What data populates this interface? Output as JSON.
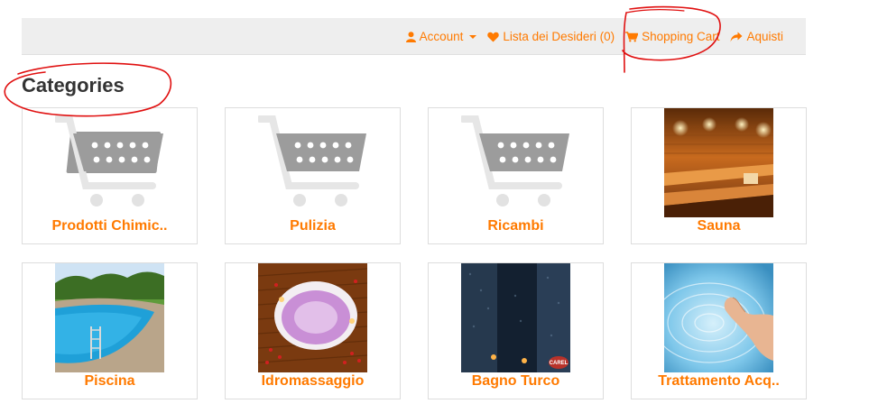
{
  "topnav": {
    "account_label": "Account",
    "wishlist_label": "Lista dei Desideri (0)",
    "cart_label": "Shopping Cart",
    "checkout_label": "Aquisti"
  },
  "page": {
    "title": "Categories"
  },
  "categories": [
    {
      "name": "Prodotti Chimic..",
      "image": "shopping-cart-placeholder"
    },
    {
      "name": "Pulizia",
      "image": "shopping-cart-placeholder"
    },
    {
      "name": "Ricambi",
      "image": "shopping-cart-placeholder"
    },
    {
      "name": "Sauna",
      "image": "sauna-photo"
    },
    {
      "name": "Piscina",
      "image": "pool-photo"
    },
    {
      "name": "Idromassaggio",
      "image": "hot-tub-photo"
    },
    {
      "name": "Bagno Turco",
      "image": "steam-bath-photo"
    },
    {
      "name": "Trattamento Acq..",
      "image": "water-hand-photo"
    }
  ],
  "colors": {
    "accent": "#ff7a00",
    "topbar": "#eeeeee",
    "title": "#333333",
    "annotation": "#e01010"
  }
}
